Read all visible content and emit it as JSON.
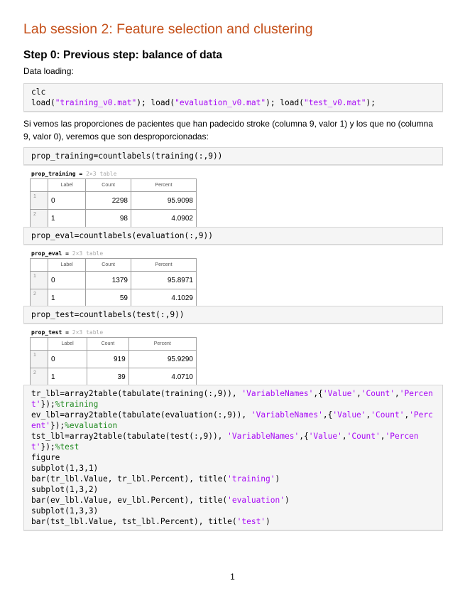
{
  "title": "Lab session 2: Feature selection and clustering",
  "step_heading": "Step 0: Previous step: balance of data",
  "text1": "Data loading:",
  "text2": "Si vemos las proporciones de pacientes que han padecido stroke (columna 9, valor 1) y los que no (columna 9, valor 0), veremos que son desproporcionadas:",
  "code1": [
    [
      [
        "clc",
        "n"
      ]
    ],
    [
      [
        "load(",
        "n"
      ],
      [
        "\"training_v0.mat\"",
        "s"
      ],
      [
        "); load(",
        "n"
      ],
      [
        "\"evaluation_v0.mat\"",
        "s"
      ],
      [
        "); load(",
        "n"
      ],
      [
        "\"test_v0.mat\"",
        "s"
      ],
      [
        ");",
        "n"
      ]
    ]
  ],
  "code2": [
    [
      [
        "prop_training=countlabels(training(:,9))",
        "n"
      ]
    ]
  ],
  "code3": [
    [
      [
        "prop_eval=countlabels(evaluation(:,9))",
        "n"
      ]
    ]
  ],
  "code4": [
    [
      [
        "prop_test=countlabels(test(:,9))",
        "n"
      ]
    ]
  ],
  "code5": [
    [
      [
        "tr_lbl=array2table(tabulate(training(:,9)), ",
        "n"
      ],
      [
        "'VariableNames'",
        "s"
      ],
      [
        ",{",
        "n"
      ],
      [
        "'Value'",
        "s"
      ],
      [
        ",",
        "n"
      ],
      [
        "'Count'",
        "s"
      ],
      [
        ",",
        "n"
      ],
      [
        "'Percent'",
        "s"
      ],
      [
        "});",
        "n"
      ],
      [
        "%training",
        "c"
      ]
    ],
    [
      [
        "ev_lbl=array2table(tabulate(evaluation(:,9)), ",
        "n"
      ],
      [
        "'VariableNames'",
        "s"
      ],
      [
        ",{",
        "n"
      ],
      [
        "'Value'",
        "s"
      ],
      [
        ",",
        "n"
      ],
      [
        "'Count'",
        "s"
      ],
      [
        ",",
        "n"
      ],
      [
        "'Percent'",
        "s"
      ],
      [
        "});",
        "n"
      ],
      [
        "%evaluation",
        "c"
      ]
    ],
    [
      [
        "tst_lbl=array2table(tabulate(test(:,9)), ",
        "n"
      ],
      [
        "'VariableNames'",
        "s"
      ],
      [
        ",{",
        "n"
      ],
      [
        "'Value'",
        "s"
      ],
      [
        ",",
        "n"
      ],
      [
        "'Count'",
        "s"
      ],
      [
        ",",
        "n"
      ],
      [
        "'Percent'",
        "s"
      ],
      [
        "});",
        "n"
      ],
      [
        "%test",
        "c"
      ]
    ],
    [
      [
        "figure",
        "n"
      ]
    ],
    [
      [
        "subplot(1,3,1)",
        "n"
      ]
    ],
    [
      [
        "bar(tr_lbl.Value, tr_lbl.Percent), title(",
        "n"
      ],
      [
        "'training'",
        "s"
      ],
      [
        ")",
        "n"
      ]
    ],
    [
      [
        "subplot(1,3,2)",
        "n"
      ]
    ],
    [
      [
        "bar(ev_lbl.Value, ev_lbl.Percent), title(",
        "n"
      ],
      [
        "'evaluation'",
        "s"
      ],
      [
        ")",
        "n"
      ]
    ],
    [
      [
        "subplot(1,3,3)",
        "n"
      ]
    ],
    [
      [
        "bar(tst_lbl.Value, tst_lbl.Percent), title(",
        "n"
      ],
      [
        "'test'",
        "s"
      ],
      [
        ")",
        "n"
      ]
    ]
  ],
  "tables": [
    {
      "name": "prop_training = ",
      "desc": "2×3 table",
      "headers": [
        "Label",
        "Count",
        "Percent"
      ],
      "rows": [
        [
          "1",
          "0",
          "2298",
          "95.9098"
        ],
        [
          "2",
          "1",
          "98",
          "4.0902"
        ]
      ]
    },
    {
      "name": "prop_eval = ",
      "desc": "2×3 table",
      "headers": [
        "Label",
        "Count",
        "Percent"
      ],
      "rows": [
        [
          "1",
          "0",
          "1379",
          "95.8971"
        ],
        [
          "2",
          "1",
          "59",
          "4.1029"
        ]
      ]
    },
    {
      "name": "prop_test = ",
      "desc": "2×3 table",
      "headers": [
        "Label",
        "Count",
        "Percent"
      ],
      "rows": [
        [
          "1",
          "0",
          "919",
          "95.9290"
        ],
        [
          "2",
          "1",
          "39",
          "4.0710"
        ]
      ]
    }
  ],
  "page_number": "1"
}
